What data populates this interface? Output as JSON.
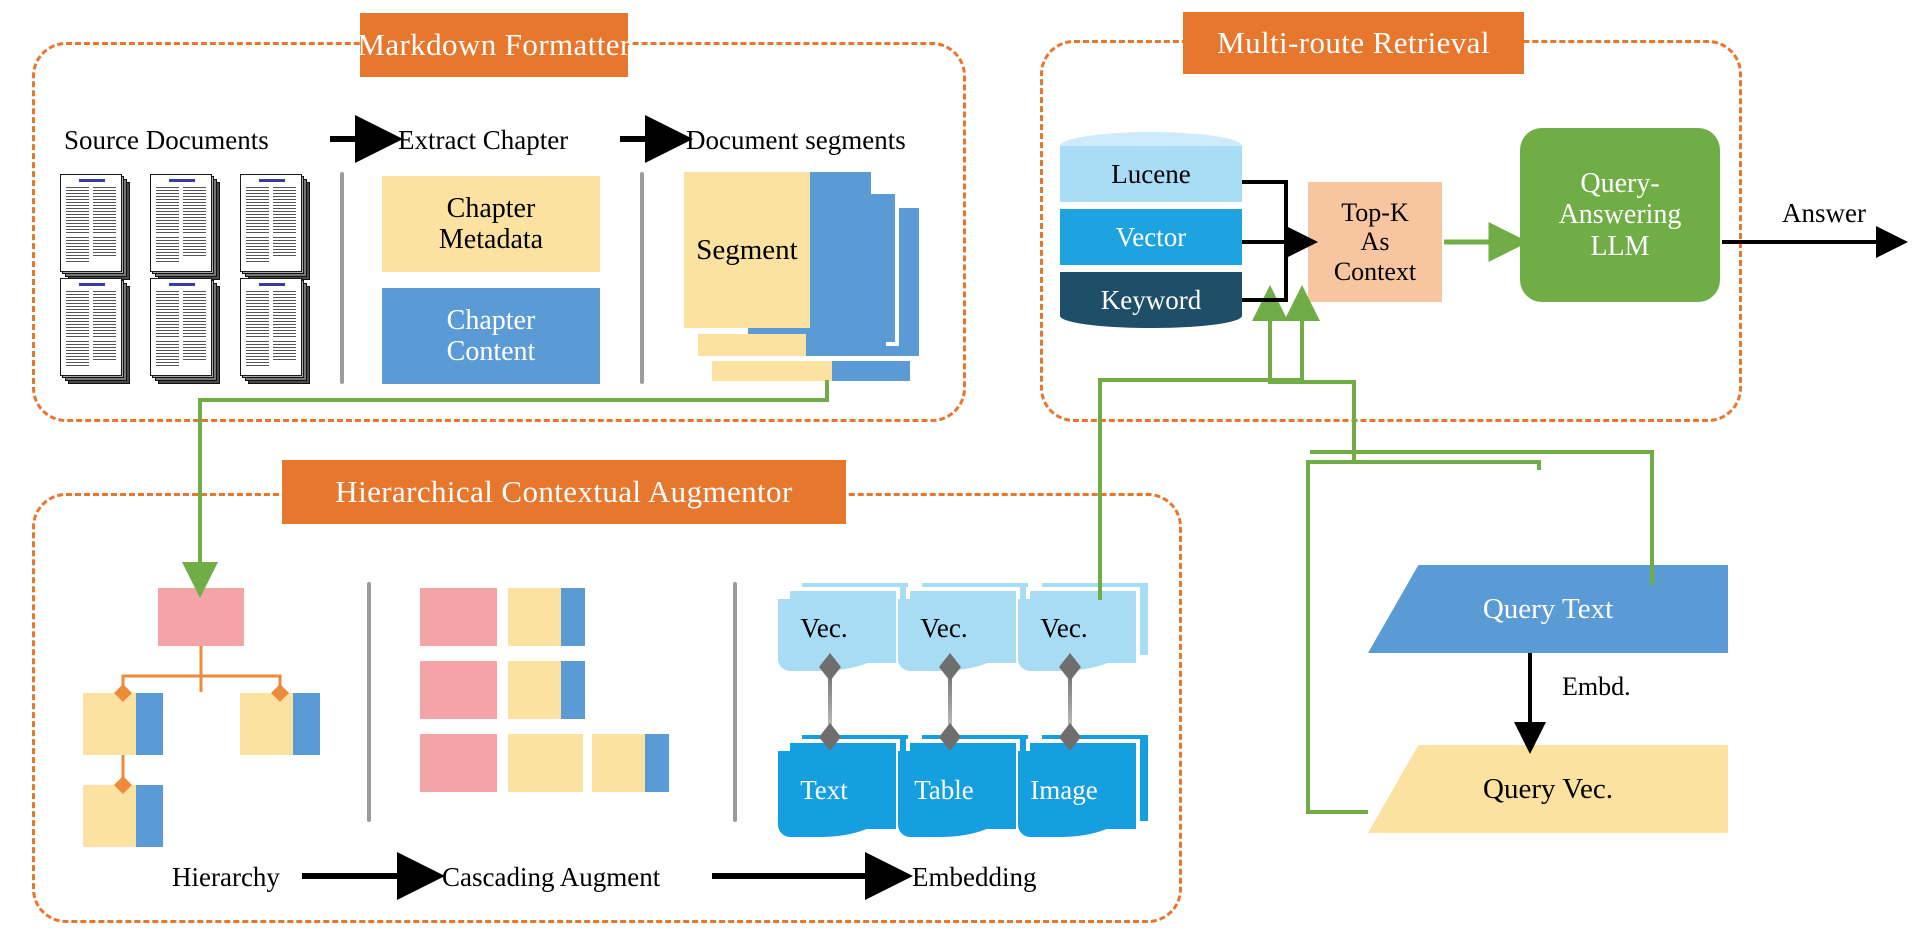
{
  "modules": {
    "markdown_formatter": {
      "title": "Markdown Formatter",
      "stage_labels": [
        "Source Documents",
        "Extract Chapter",
        "Document segments"
      ],
      "blocks": {
        "chapter_metadata": "Chapter\nMetadata",
        "chapter_metadata_line1": "Chapter",
        "chapter_metadata_line2": "Metadata",
        "chapter_content_line1": "Chapter",
        "chapter_content_line2": "Content",
        "segment": "Segment"
      }
    },
    "hierarchical_contextual_augmentor": {
      "title": "Hierarchical Contextual Augmentor",
      "stage_labels": [
        "Hierarchy",
        "Cascading Augment",
        "Embedding"
      ],
      "embedding_pairs": [
        {
          "vector_label": "Vec.",
          "content_label": "Text"
        },
        {
          "vector_label": "Vec.",
          "content_label": "Table"
        },
        {
          "vector_label": "Vec.",
          "content_label": "Image"
        }
      ]
    },
    "multi_route_retrieval": {
      "title": "Multi-route Retrieval",
      "database": {
        "segments": [
          "Lucene",
          "Vector",
          "Keyword"
        ]
      },
      "topk_line1": "Top-K",
      "topk_line2": "As",
      "topk_line3": "Context",
      "llm_line1": "Query-",
      "llm_line2": "Answering",
      "llm_line3": "LLM",
      "answer_label": "Answer"
    }
  },
  "query_flow": {
    "query_text": "Query Text",
    "embed_label": "Embd.",
    "query_vec": "Query Vec."
  },
  "colors": {
    "orange": "#E8772E",
    "yellow": "#FCE2A0",
    "blue": "#5B9BD5",
    "pink": "#F4A3A6",
    "green_arrow": "#70AD47",
    "llm_green": "#70AD47",
    "peach": "#F7C59F",
    "lucene": "#A9DCF5",
    "vector": "#1CA3E0",
    "keyword": "#1F4E68",
    "card_light": "#A8DCF5",
    "card_dark": "#159FE0",
    "separator": "#9B9B9B"
  }
}
